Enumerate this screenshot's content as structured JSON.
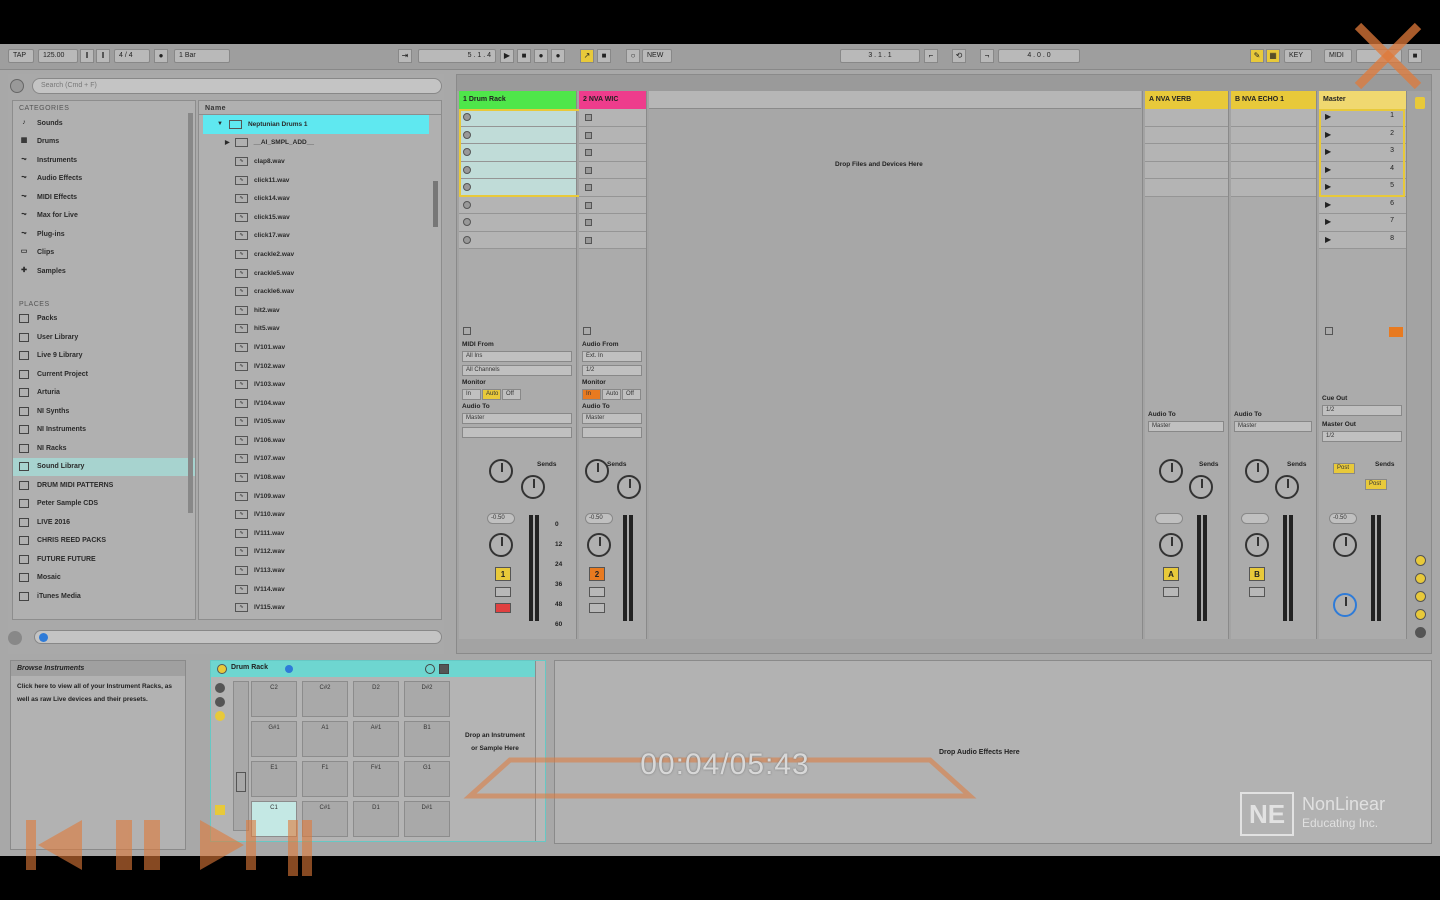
{
  "transport": {
    "tap": "TAP",
    "tempo": "125.00",
    "time_sig": "4 / 4",
    "metro": "1 Bar",
    "position": "5 . 1 . 4",
    "new_label": "NEW",
    "loop_start": "3 . 1 . 1",
    "loop_len": "4 . 0 . 0",
    "key_label": "KEY",
    "midi_label": "MIDI"
  },
  "browser": {
    "search_placeholder": "Search (Cmd + F)",
    "categories_head": "CATEGORIES",
    "categories": [
      "Sounds",
      "Drums",
      "Instruments",
      "Audio Effects",
      "MIDI Effects",
      "Max for Live",
      "Plug-ins",
      "Clips",
      "Samples"
    ],
    "places_head": "PLACES",
    "places": [
      "Packs",
      "User Library",
      "Live 9 Library",
      "Current Project",
      "Arturia",
      "NI Synths",
      "NI Instruments",
      "NI Racks",
      "Sound Library",
      "DRUM MIDI PATTERNS",
      "Peter Sample CDS",
      "LIVE 2016",
      "CHRIS REED PACKS",
      "FUTURE FUTURE",
      "Mosaic",
      "iTunes Media"
    ],
    "name_head": "Name",
    "folder": "Neptunian Drums 1",
    "subfolder": "__AI_SMPL_ADD__",
    "files": [
      "clap8.wav",
      "click11.wav",
      "click14.wav",
      "click15.wav",
      "click17.wav",
      "crackle2.wav",
      "crackle5.wav",
      "crackle6.wav",
      "hit2.wav",
      "hit5.wav",
      "IV101.wav",
      "IV102.wav",
      "IV103.wav",
      "IV104.wav",
      "IV105.wav",
      "IV106.wav",
      "IV107.wav",
      "IV108.wav",
      "IV109.wav",
      "IV110.wav",
      "IV111.wav",
      "IV112.wav",
      "IV113.wav",
      "IV114.wav",
      "IV115.wav"
    ]
  },
  "session": {
    "tracks": [
      {
        "name": "1 Drum Rack",
        "color": "#4fe64a",
        "num": "1",
        "num_color": "#e8c93a"
      },
      {
        "name": "2 NVA WIC",
        "color": "#ee3c8c",
        "num": "2",
        "num_color": "#e87a20"
      }
    ],
    "drop_text": "Drop Files and Devices Here",
    "returns": [
      {
        "name": "A NVA VERB",
        "letter": "A"
      },
      {
        "name": "B NVA ECHO 1",
        "letter": "B"
      }
    ],
    "master": "Master",
    "scenes": [
      "1",
      "2",
      "3",
      "4",
      "5",
      "6",
      "7",
      "8"
    ],
    "midi_from": "MIDI From",
    "all_ins": "All Ins",
    "all_channels": "All Channels",
    "audio_from": "Audio From",
    "ext_in": "Ext. In",
    "in_ch": "1/2",
    "monitor": "Monitor",
    "mon_in": "In",
    "mon_auto": "Auto",
    "mon_off": "Off",
    "audio_to": "Audio To",
    "master_dest": "Master",
    "cue_out": "Cue Out",
    "master_out": "Master Out",
    "out_ch": "1/2",
    "sends": "Sends",
    "vol": "-0.50",
    "db_labels": [
      "0",
      "12",
      "24",
      "36",
      "48",
      "60"
    ],
    "post": "Post"
  },
  "detail": {
    "info_title": "Browse Instruments",
    "info_text": "Click here to view all of your Instrument Racks, as well as raw Live devices and their presets.",
    "rack_title": "Drum Rack",
    "pads": [
      "C2",
      "C#2",
      "D2",
      "D#2",
      "G#1",
      "A1",
      "A#1",
      "B1",
      "E1",
      "F1",
      "F#1",
      "G1",
      "C1",
      "C#1",
      "D1",
      "D#1"
    ],
    "drop_instrument": "Drop an Instrument or Sample Here",
    "drop_fx": "Drop Audio Effects Here"
  },
  "player": {
    "time": "00:04/05:43",
    "logo_text1": "NonLinear",
    "logo_text2": "Educating Inc.",
    "logo_mark": "NE"
  }
}
